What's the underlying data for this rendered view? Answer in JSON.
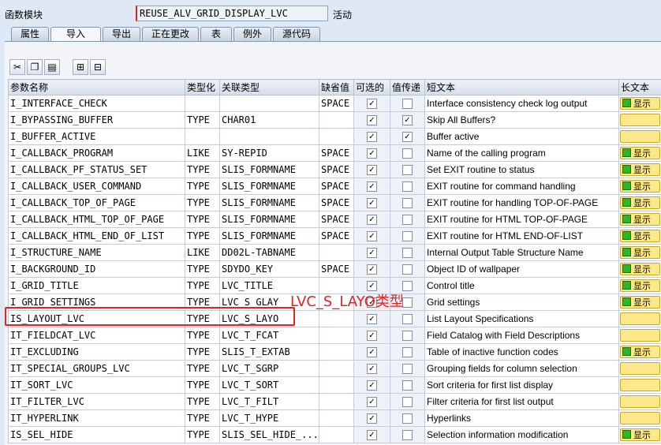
{
  "header": {
    "label": "函数模块",
    "function_module": "REUSE_ALV_GRID_DISPLAY_LVC",
    "status": "活动"
  },
  "tabs": [
    {
      "label": "属性",
      "active": false
    },
    {
      "label": "导入",
      "active": true
    },
    {
      "label": "导出",
      "active": false
    },
    {
      "label": "正在更改",
      "active": false
    },
    {
      "label": "表",
      "active": false
    },
    {
      "label": "例外",
      "active": false
    },
    {
      "label": "源代码",
      "active": false
    }
  ],
  "columns": [
    "参数名称",
    "类型化",
    "关联类型",
    "缺省值",
    "可选的",
    "值传递",
    "短文本",
    "长文本"
  ],
  "long_text_label": "显示",
  "rows": [
    {
      "name": "I_INTERFACE_CHECK",
      "typing": "",
      "ref": "",
      "default": "SPACE",
      "optional": true,
      "pass_value": false,
      "short": "Interface consistency check log output",
      "long": true
    },
    {
      "name": "I_BYPASSING_BUFFER",
      "typing": "TYPE",
      "ref": "CHAR01",
      "default": "",
      "optional": true,
      "pass_value": true,
      "short": "Skip All Buffers?",
      "long": false
    },
    {
      "name": "I_BUFFER_ACTIVE",
      "typing": "",
      "ref": "",
      "default": "",
      "optional": true,
      "pass_value": true,
      "short": "Buffer active",
      "long": false
    },
    {
      "name": "I_CALLBACK_PROGRAM",
      "typing": "LIKE",
      "ref": "SY-REPID",
      "default": "SPACE",
      "optional": true,
      "pass_value": false,
      "short": "Name of the calling program",
      "long": true
    },
    {
      "name": "I_CALLBACK_PF_STATUS_SET",
      "typing": "TYPE",
      "ref": "SLIS_FORMNAME",
      "default": "SPACE",
      "optional": true,
      "pass_value": false,
      "short": "Set EXIT routine to status",
      "long": true
    },
    {
      "name": "I_CALLBACK_USER_COMMAND",
      "typing": "TYPE",
      "ref": "SLIS_FORMNAME",
      "default": "SPACE",
      "optional": true,
      "pass_value": false,
      "short": "EXIT routine for command handling",
      "long": true
    },
    {
      "name": "I_CALLBACK_TOP_OF_PAGE",
      "typing": "TYPE",
      "ref": "SLIS_FORMNAME",
      "default": "SPACE",
      "optional": true,
      "pass_value": false,
      "short": "EXIT routine for handling TOP-OF-PAGE",
      "long": true
    },
    {
      "name": "I_CALLBACK_HTML_TOP_OF_PAGE",
      "typing": "TYPE",
      "ref": "SLIS_FORMNAME",
      "default": "SPACE",
      "optional": true,
      "pass_value": false,
      "short": "EXIT routine for HTML TOP-OF-PAGE",
      "long": true
    },
    {
      "name": "I_CALLBACK_HTML_END_OF_LIST",
      "typing": "TYPE",
      "ref": "SLIS_FORMNAME",
      "default": "SPACE",
      "optional": true,
      "pass_value": false,
      "short": "EXIT routine for HTML END-OF-LIST",
      "long": true
    },
    {
      "name": "I_STRUCTURE_NAME",
      "typing": "LIKE",
      "ref": "DD02L-TABNAME",
      "default": "",
      "optional": true,
      "pass_value": false,
      "short": "Internal Output Table Structure Name",
      "long": true
    },
    {
      "name": "I_BACKGROUND_ID",
      "typing": "TYPE",
      "ref": "SDYDO_KEY",
      "default": "SPACE",
      "optional": true,
      "pass_value": false,
      "short": "Object ID of wallpaper",
      "long": true
    },
    {
      "name": "I_GRID_TITLE",
      "typing": "TYPE",
      "ref": "LVC_TITLE",
      "default": "",
      "optional": true,
      "pass_value": false,
      "short": "Control title",
      "long": true
    },
    {
      "name": "I_GRID_SETTINGS",
      "typing": "TYPE",
      "ref": "LVC_S_GLAY",
      "default": "",
      "optional": true,
      "pass_value": false,
      "short": "Grid settings",
      "long": true
    },
    {
      "name": "IS_LAYOUT_LVC",
      "typing": "TYPE",
      "ref": "LVC_S_LAYO",
      "default": "",
      "optional": true,
      "pass_value": false,
      "short": "List Layout Specifications",
      "long": false
    },
    {
      "name": "IT_FIELDCAT_LVC",
      "typing": "TYPE",
      "ref": "LVC_T_FCAT",
      "default": "",
      "optional": true,
      "pass_value": false,
      "short": "Field Catalog with Field Descriptions",
      "long": false
    },
    {
      "name": "IT_EXCLUDING",
      "typing": "TYPE",
      "ref": "SLIS_T_EXTAB",
      "default": "",
      "optional": true,
      "pass_value": false,
      "short": "Table of inactive function codes",
      "long": true
    },
    {
      "name": "IT_SPECIAL_GROUPS_LVC",
      "typing": "TYPE",
      "ref": "LVC_T_SGRP",
      "default": "",
      "optional": true,
      "pass_value": false,
      "short": "Grouping fields for column selection",
      "long": false
    },
    {
      "name": "IT_SORT_LVC",
      "typing": "TYPE",
      "ref": "LVC_T_SORT",
      "default": "",
      "optional": true,
      "pass_value": false,
      "short": "Sort criteria for first list display",
      "long": false
    },
    {
      "name": "IT_FILTER_LVC",
      "typing": "TYPE",
      "ref": "LVC_T_FILT",
      "default": "",
      "optional": true,
      "pass_value": false,
      "short": "Filter criteria for first list output",
      "long": false
    },
    {
      "name": "IT_HYPERLINK",
      "typing": "TYPE",
      "ref": "LVC_T_HYPE",
      "default": "",
      "optional": true,
      "pass_value": false,
      "short": "Hyperlinks",
      "long": false
    },
    {
      "name": "IS_SEL_HIDE",
      "typing": "TYPE",
      "ref": "SLIS_SEL_HIDE_...",
      "default": "",
      "optional": true,
      "pass_value": false,
      "short": "Selection information modification",
      "long": true
    }
  ],
  "annotation": "LVC_S_LAYO类型",
  "colors": {
    "highlight": "#e32222",
    "long_text_button": "#fde98a",
    "status_green": "#2fb52a"
  }
}
